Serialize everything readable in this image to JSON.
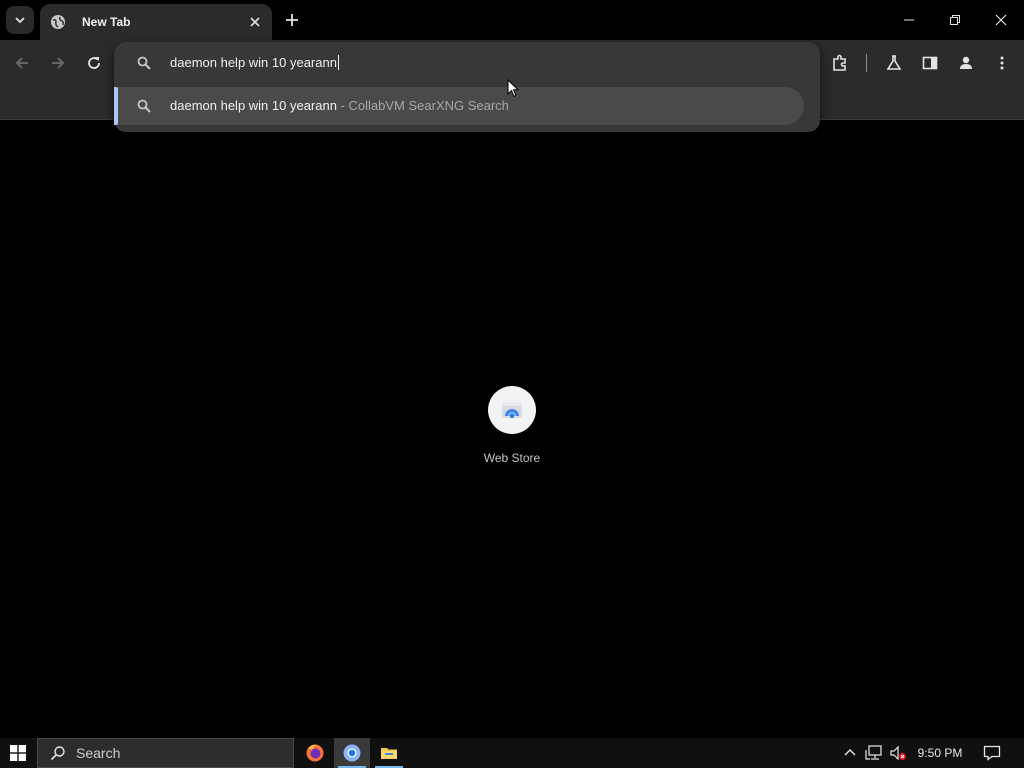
{
  "browser": {
    "tab": {
      "title": "New Tab"
    },
    "omnibox": {
      "input_value": "daemon help win 10 yearann",
      "suggestion": {
        "text": "daemon help win 10 yearann",
        "separator": " - ",
        "engine": "CollabVM SearXNG Search"
      }
    },
    "colors": {
      "accent": "#a8c7fa",
      "toolbar_bg": "#2b2b2b",
      "popup_bg": "#383838"
    }
  },
  "ntp": {
    "shortcuts": [
      {
        "label": "Web Store",
        "icon": "web-store-icon"
      }
    ]
  },
  "taskbar": {
    "search_placeholder": "Search",
    "apps": [
      {
        "name": "firefox",
        "icon": "firefox-icon"
      },
      {
        "name": "chrome",
        "icon": "chrome-icon",
        "active": true
      },
      {
        "name": "file-explorer",
        "icon": "folder-icon"
      }
    ],
    "clock": "9:50 PM"
  }
}
